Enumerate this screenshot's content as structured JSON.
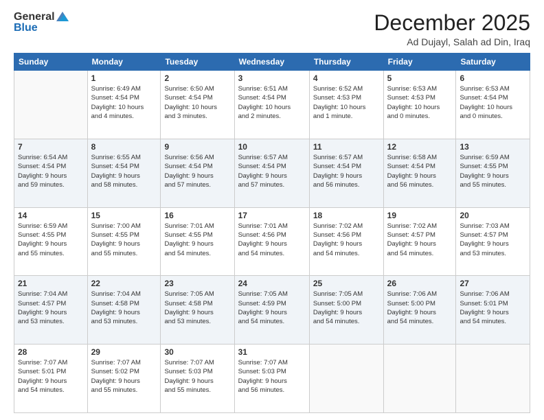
{
  "header": {
    "logo_general": "General",
    "logo_blue": "Blue",
    "title": "December 2025",
    "subtitle": "Ad Dujayl, Salah ad Din, Iraq"
  },
  "weekdays": [
    "Sunday",
    "Monday",
    "Tuesday",
    "Wednesday",
    "Thursday",
    "Friday",
    "Saturday"
  ],
  "weeks": [
    [
      {
        "day": "",
        "info": ""
      },
      {
        "day": "1",
        "info": "Sunrise: 6:49 AM\nSunset: 4:54 PM\nDaylight: 10 hours\nand 4 minutes."
      },
      {
        "day": "2",
        "info": "Sunrise: 6:50 AM\nSunset: 4:54 PM\nDaylight: 10 hours\nand 3 minutes."
      },
      {
        "day": "3",
        "info": "Sunrise: 6:51 AM\nSunset: 4:54 PM\nDaylight: 10 hours\nand 2 minutes."
      },
      {
        "day": "4",
        "info": "Sunrise: 6:52 AM\nSunset: 4:53 PM\nDaylight: 10 hours\nand 1 minute."
      },
      {
        "day": "5",
        "info": "Sunrise: 6:53 AM\nSunset: 4:53 PM\nDaylight: 10 hours\nand 0 minutes."
      },
      {
        "day": "6",
        "info": "Sunrise: 6:53 AM\nSunset: 4:54 PM\nDaylight: 10 hours\nand 0 minutes."
      }
    ],
    [
      {
        "day": "7",
        "info": "Sunrise: 6:54 AM\nSunset: 4:54 PM\nDaylight: 9 hours\nand 59 minutes."
      },
      {
        "day": "8",
        "info": "Sunrise: 6:55 AM\nSunset: 4:54 PM\nDaylight: 9 hours\nand 58 minutes."
      },
      {
        "day": "9",
        "info": "Sunrise: 6:56 AM\nSunset: 4:54 PM\nDaylight: 9 hours\nand 57 minutes."
      },
      {
        "day": "10",
        "info": "Sunrise: 6:57 AM\nSunset: 4:54 PM\nDaylight: 9 hours\nand 57 minutes."
      },
      {
        "day": "11",
        "info": "Sunrise: 6:57 AM\nSunset: 4:54 PM\nDaylight: 9 hours\nand 56 minutes."
      },
      {
        "day": "12",
        "info": "Sunrise: 6:58 AM\nSunset: 4:54 PM\nDaylight: 9 hours\nand 56 minutes."
      },
      {
        "day": "13",
        "info": "Sunrise: 6:59 AM\nSunset: 4:55 PM\nDaylight: 9 hours\nand 55 minutes."
      }
    ],
    [
      {
        "day": "14",
        "info": "Sunrise: 6:59 AM\nSunset: 4:55 PM\nDaylight: 9 hours\nand 55 minutes."
      },
      {
        "day": "15",
        "info": "Sunrise: 7:00 AM\nSunset: 4:55 PM\nDaylight: 9 hours\nand 55 minutes."
      },
      {
        "day": "16",
        "info": "Sunrise: 7:01 AM\nSunset: 4:55 PM\nDaylight: 9 hours\nand 54 minutes."
      },
      {
        "day": "17",
        "info": "Sunrise: 7:01 AM\nSunset: 4:56 PM\nDaylight: 9 hours\nand 54 minutes."
      },
      {
        "day": "18",
        "info": "Sunrise: 7:02 AM\nSunset: 4:56 PM\nDaylight: 9 hours\nand 54 minutes."
      },
      {
        "day": "19",
        "info": "Sunrise: 7:02 AM\nSunset: 4:57 PM\nDaylight: 9 hours\nand 54 minutes."
      },
      {
        "day": "20",
        "info": "Sunrise: 7:03 AM\nSunset: 4:57 PM\nDaylight: 9 hours\nand 53 minutes."
      }
    ],
    [
      {
        "day": "21",
        "info": "Sunrise: 7:04 AM\nSunset: 4:57 PM\nDaylight: 9 hours\nand 53 minutes."
      },
      {
        "day": "22",
        "info": "Sunrise: 7:04 AM\nSunset: 4:58 PM\nDaylight: 9 hours\nand 53 minutes."
      },
      {
        "day": "23",
        "info": "Sunrise: 7:05 AM\nSunset: 4:58 PM\nDaylight: 9 hours\nand 53 minutes."
      },
      {
        "day": "24",
        "info": "Sunrise: 7:05 AM\nSunset: 4:59 PM\nDaylight: 9 hours\nand 54 minutes."
      },
      {
        "day": "25",
        "info": "Sunrise: 7:05 AM\nSunset: 5:00 PM\nDaylight: 9 hours\nand 54 minutes."
      },
      {
        "day": "26",
        "info": "Sunrise: 7:06 AM\nSunset: 5:00 PM\nDaylight: 9 hours\nand 54 minutes."
      },
      {
        "day": "27",
        "info": "Sunrise: 7:06 AM\nSunset: 5:01 PM\nDaylight: 9 hours\nand 54 minutes."
      }
    ],
    [
      {
        "day": "28",
        "info": "Sunrise: 7:07 AM\nSunset: 5:01 PM\nDaylight: 9 hours\nand 54 minutes."
      },
      {
        "day": "29",
        "info": "Sunrise: 7:07 AM\nSunset: 5:02 PM\nDaylight: 9 hours\nand 55 minutes."
      },
      {
        "day": "30",
        "info": "Sunrise: 7:07 AM\nSunset: 5:03 PM\nDaylight: 9 hours\nand 55 minutes."
      },
      {
        "day": "31",
        "info": "Sunrise: 7:07 AM\nSunset: 5:03 PM\nDaylight: 9 hours\nand 56 minutes."
      },
      {
        "day": "",
        "info": ""
      },
      {
        "day": "",
        "info": ""
      },
      {
        "day": "",
        "info": ""
      }
    ]
  ]
}
